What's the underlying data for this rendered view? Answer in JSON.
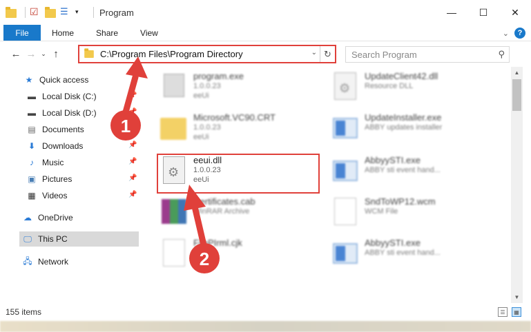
{
  "window": {
    "title": "Program",
    "controls": {
      "minimize": "—",
      "maximize": "☐",
      "close": "✕"
    }
  },
  "ribbon": {
    "tabs": [
      "File",
      "Home",
      "Share",
      "View"
    ],
    "help": "?"
  },
  "address": {
    "path": "C:\\Program Files\\Program Directory",
    "search_placeholder": "Search Program"
  },
  "nav": {
    "items": [
      {
        "label": "Quick access",
        "icon": "star-icon",
        "pinned": false
      },
      {
        "label": "Local Disk (C:)",
        "icon": "drive-icon",
        "pinned": true
      },
      {
        "label": "Local Disk (D:)",
        "icon": "drive-icon",
        "pinned": true
      },
      {
        "label": "Documents",
        "icon": "documents-icon",
        "pinned": true
      },
      {
        "label": "Downloads",
        "icon": "download-icon",
        "pinned": true
      },
      {
        "label": "Music",
        "icon": "music-icon",
        "pinned": true
      },
      {
        "label": "Pictures",
        "icon": "pictures-icon",
        "pinned": true
      },
      {
        "label": "Videos",
        "icon": "videos-icon",
        "pinned": true
      },
      {
        "label": "OneDrive",
        "icon": "onedrive-icon",
        "pinned": false
      },
      {
        "label": "This PC",
        "icon": "computer-icon",
        "pinned": false,
        "selected": true
      },
      {
        "label": "Network",
        "icon": "network-icon",
        "pinned": false
      }
    ]
  },
  "files": [
    {
      "name": "program.exe",
      "line1": "1.0.0.23",
      "line2": "eeUi",
      "icon": "exe-icon",
      "blurred": true
    },
    {
      "name": "UpdateClient42.dll",
      "line1": "Resource DLL",
      "line2": "",
      "icon": "gear-doc-icon",
      "blurred": true
    },
    {
      "name": "Microsoft.VC90.CRT",
      "line1": "1.0.0.23",
      "line2": "eeUi",
      "icon": "folder-icon",
      "blurred": true
    },
    {
      "name": "UpdateInstaller.exe",
      "line1": "ABBY updates installer",
      "line2": "",
      "icon": "window-icon",
      "blurred": true
    },
    {
      "name": "eeui.dll",
      "line1": "1.0.0.23",
      "line2": "eeUi",
      "icon": "gear-doc-icon",
      "blurred": false
    },
    {
      "name": "AbbyySTI.exe",
      "line1": "ABBY sti event hand...",
      "line2": "",
      "icon": "window-icon",
      "blurred": true
    },
    {
      "name": "Certificates.cab",
      "line1": "WinRAR Archive",
      "line2": "",
      "icon": "winrar-icon",
      "blurred": true
    },
    {
      "name": "SndToWP12.wcm",
      "line1": "WCM File",
      "line2": "",
      "icon": "doc-icon",
      "blurred": true
    },
    {
      "name": "FilePIrml.cjk",
      "line1": "",
      "line2": "",
      "icon": "doc-icon",
      "blurred": true
    },
    {
      "name": "AbbyySTI.exe",
      "line1": "ABBY sti event hand...",
      "line2": "",
      "icon": "window-icon",
      "blurred": true
    }
  ],
  "annotations": {
    "step1": "1",
    "step2": "2",
    "color": "#e0403a"
  },
  "status": {
    "count": "155 items"
  }
}
